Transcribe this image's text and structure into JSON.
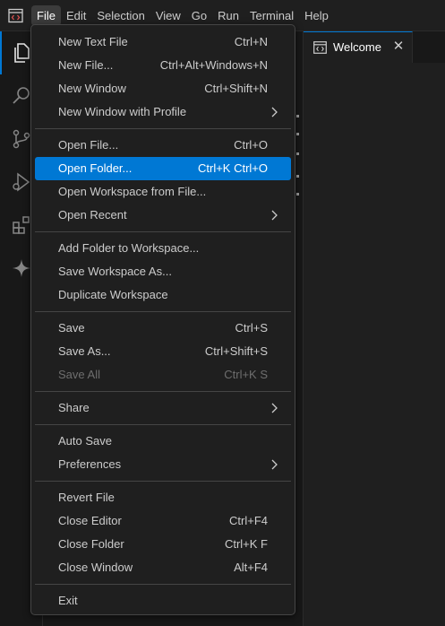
{
  "menubar": {
    "items": [
      "File",
      "Edit",
      "Selection",
      "View",
      "Go",
      "Run",
      "Terminal",
      "Help"
    ],
    "active": "File"
  },
  "activity_icons": [
    "explorer-icon",
    "search-icon",
    "source-control-icon",
    "run-debug-icon",
    "extensions-icon",
    "copilot-icon"
  ],
  "editor": {
    "tab_label": "Welcome",
    "tab_close": "✕"
  },
  "file_menu": {
    "groups": [
      [
        {
          "label": "New Text File",
          "shortcut": "Ctrl+N"
        },
        {
          "label": "New File...",
          "shortcut": "Ctrl+Alt+Windows+N"
        },
        {
          "label": "New Window",
          "shortcut": "Ctrl+Shift+N"
        },
        {
          "label": "New Window with Profile",
          "shortcut": "",
          "submenu": true
        }
      ],
      [
        {
          "label": "Open File...",
          "shortcut": "Ctrl+O"
        },
        {
          "label": "Open Folder...",
          "shortcut": "Ctrl+K Ctrl+O",
          "highlighted": true
        },
        {
          "label": "Open Workspace from File...",
          "shortcut": ""
        },
        {
          "label": "Open Recent",
          "shortcut": "",
          "submenu": true
        }
      ],
      [
        {
          "label": "Add Folder to Workspace...",
          "shortcut": ""
        },
        {
          "label": "Save Workspace As...",
          "shortcut": ""
        },
        {
          "label": "Duplicate Workspace",
          "shortcut": ""
        }
      ],
      [
        {
          "label": "Save",
          "shortcut": "Ctrl+S"
        },
        {
          "label": "Save As...",
          "shortcut": "Ctrl+Shift+S"
        },
        {
          "label": "Save All",
          "shortcut": "Ctrl+K S",
          "disabled": true
        }
      ],
      [
        {
          "label": "Share",
          "shortcut": "",
          "submenu": true
        }
      ],
      [
        {
          "label": "Auto Save",
          "shortcut": ""
        },
        {
          "label": "Preferences",
          "shortcut": "",
          "submenu": true
        }
      ],
      [
        {
          "label": "Revert File",
          "shortcut": ""
        },
        {
          "label": "Close Editor",
          "shortcut": "Ctrl+F4"
        },
        {
          "label": "Close Folder",
          "shortcut": "Ctrl+K F"
        },
        {
          "label": "Close Window",
          "shortcut": "Alt+F4"
        }
      ],
      [
        {
          "label": "Exit",
          "shortcut": ""
        }
      ]
    ]
  },
  "colors": {
    "accent": "#0078d4",
    "menu_bg": "#1f1f1f",
    "text": "#cccccc",
    "disabled_text": "#6e6e6e"
  }
}
